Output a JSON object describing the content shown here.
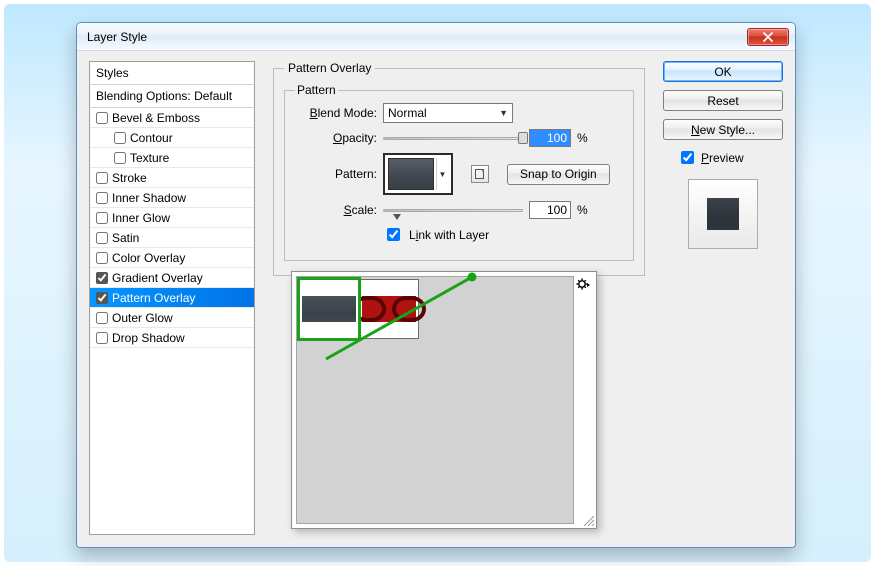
{
  "window": {
    "title": "Layer Style"
  },
  "sidebar": {
    "styles_header": "Styles",
    "blending_header": "Blending Options: Default",
    "items": [
      {
        "label": "Bevel & Emboss",
        "checked": false,
        "indent": false
      },
      {
        "label": "Contour",
        "checked": false,
        "indent": true
      },
      {
        "label": "Texture",
        "checked": false,
        "indent": true
      },
      {
        "label": "Stroke",
        "checked": false,
        "indent": false
      },
      {
        "label": "Inner Shadow",
        "checked": false,
        "indent": false
      },
      {
        "label": "Inner Glow",
        "checked": false,
        "indent": false
      },
      {
        "label": "Satin",
        "checked": false,
        "indent": false
      },
      {
        "label": "Color Overlay",
        "checked": false,
        "indent": false
      },
      {
        "label": "Gradient Overlay",
        "checked": true,
        "indent": false
      },
      {
        "label": "Pattern Overlay",
        "checked": true,
        "indent": false,
        "selected": true
      },
      {
        "label": "Outer Glow",
        "checked": false,
        "indent": false
      },
      {
        "label": "Drop Shadow",
        "checked": false,
        "indent": false
      }
    ]
  },
  "panel": {
    "group_title": "Pattern Overlay",
    "inner_title": "Pattern",
    "blend_label": "Blend Mode:",
    "blend_value": "Normal",
    "opacity_label": "Opacity:",
    "opacity_value": "100",
    "opacity_unit": "%",
    "pattern_label": "Pattern:",
    "snap_label": "Snap to Origin",
    "scale_label": "Scale:",
    "scale_value": "100",
    "scale_unit": "%",
    "link_label": "Link with Layer"
  },
  "right": {
    "ok": "OK",
    "reset": "Reset",
    "new_style": "New Style...",
    "preview_label": "Preview"
  },
  "popup": {
    "items": [
      {
        "name": "dark-slate",
        "selected": true
      },
      {
        "name": "red-rings",
        "selected": false
      }
    ]
  }
}
